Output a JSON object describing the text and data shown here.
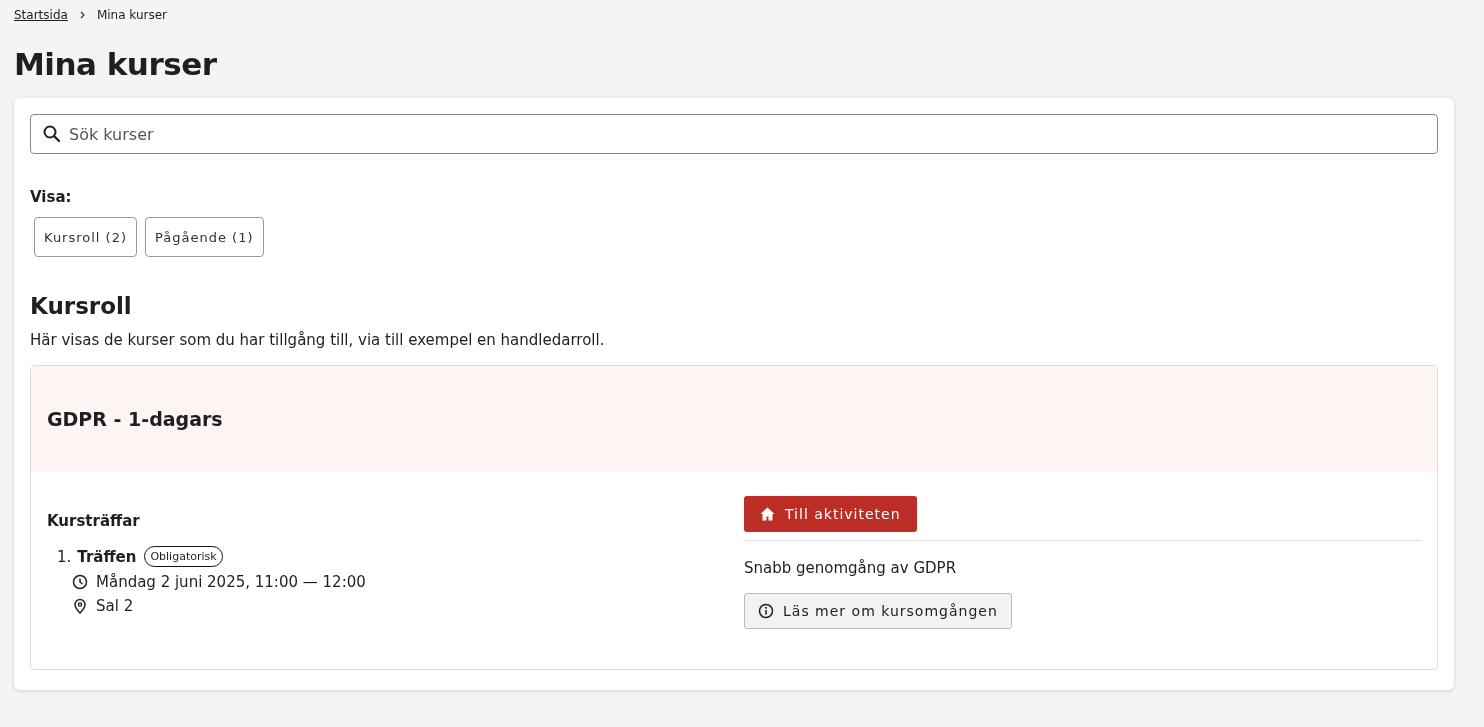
{
  "breadcrumb": [
    {
      "label": "Startsida",
      "kind": "link"
    },
    {
      "label": "Mina kurser",
      "kind": "current"
    }
  ],
  "page_title": "Mina kurser",
  "search": {
    "placeholder": "Sök kurser"
  },
  "filter": {
    "label": "Visa:",
    "options": [
      "Kursroll (2)",
      "Pågående (1)"
    ]
  },
  "section": {
    "title": "Kursroll",
    "description": "Här visas de kurser som du har tillgång till, via till exempel en handledarroll."
  },
  "courses": [
    {
      "title": "GDPR - 1-dagars",
      "sessions_title": "Kursträffar",
      "sessions": [
        {
          "number": "1.",
          "name": "Träffen",
          "badge": "Obligatorisk",
          "time": "Måndag 2 juni 2025, 11:00 — 12:00",
          "location": "Sal 2"
        }
      ],
      "action": "Till aktiviteten",
      "summary": "Snabb genomgång av GDPR",
      "info_button": "Läs mer om kursomgången"
    }
  ]
}
